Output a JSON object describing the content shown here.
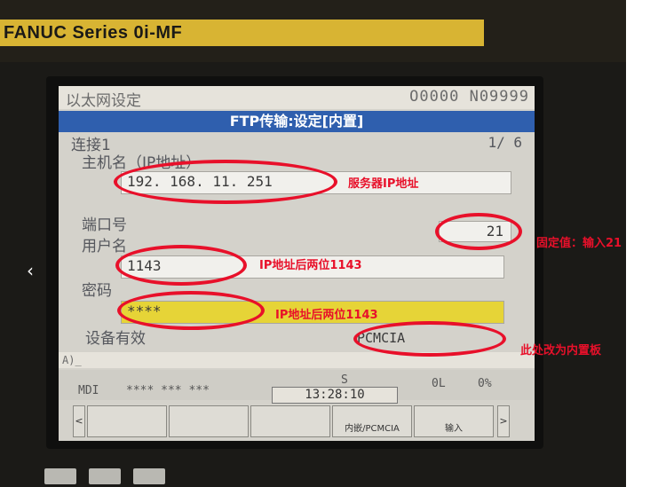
{
  "header": {
    "brand": "FANUC Series 0i-MF",
    "screen_title": "以太网设定",
    "program_info": "O0000 N09999"
  },
  "ftp_bar": "FTP传输:设定[内置]",
  "connection_label": "连接1",
  "page_indicator": "1/ 6",
  "fields": {
    "host_label": "主机名（IP地址）",
    "host_value": "192. 168. 11. 251",
    "port_label": "端口号",
    "port_value": "21",
    "user_label": "用户名",
    "user_value": "1143",
    "password_label": "密码",
    "password_value": "****",
    "device_label": "设备有效",
    "device_value": "PCMCIA"
  },
  "input_prompt": "A)_",
  "status": {
    "mode": "MDI",
    "stars": "**** *** ***",
    "s_label": "S",
    "l_value": "0L",
    "percent": "0%",
    "time": "13:28:10"
  },
  "softkeys": {
    "left_arrow": "<",
    "key4": "内嵌/PCMCIA",
    "key5": "输入",
    "right_arrow": ">"
  },
  "annotations": {
    "server_ip": "服务器IP地址",
    "port_fixed": "固定值：输入21",
    "user_note": "IP地址后两位1143",
    "password_note": "IP地址后两位1143",
    "device_note": "此处改为内置板"
  },
  "colors": {
    "annotation_red": "#e8102a",
    "title_bar_blue": "#2f5fae",
    "password_yellow": "#e6d437",
    "brand_gold": "#d8b433"
  },
  "icons": {
    "prev_nav": "chevron-left-icon"
  }
}
